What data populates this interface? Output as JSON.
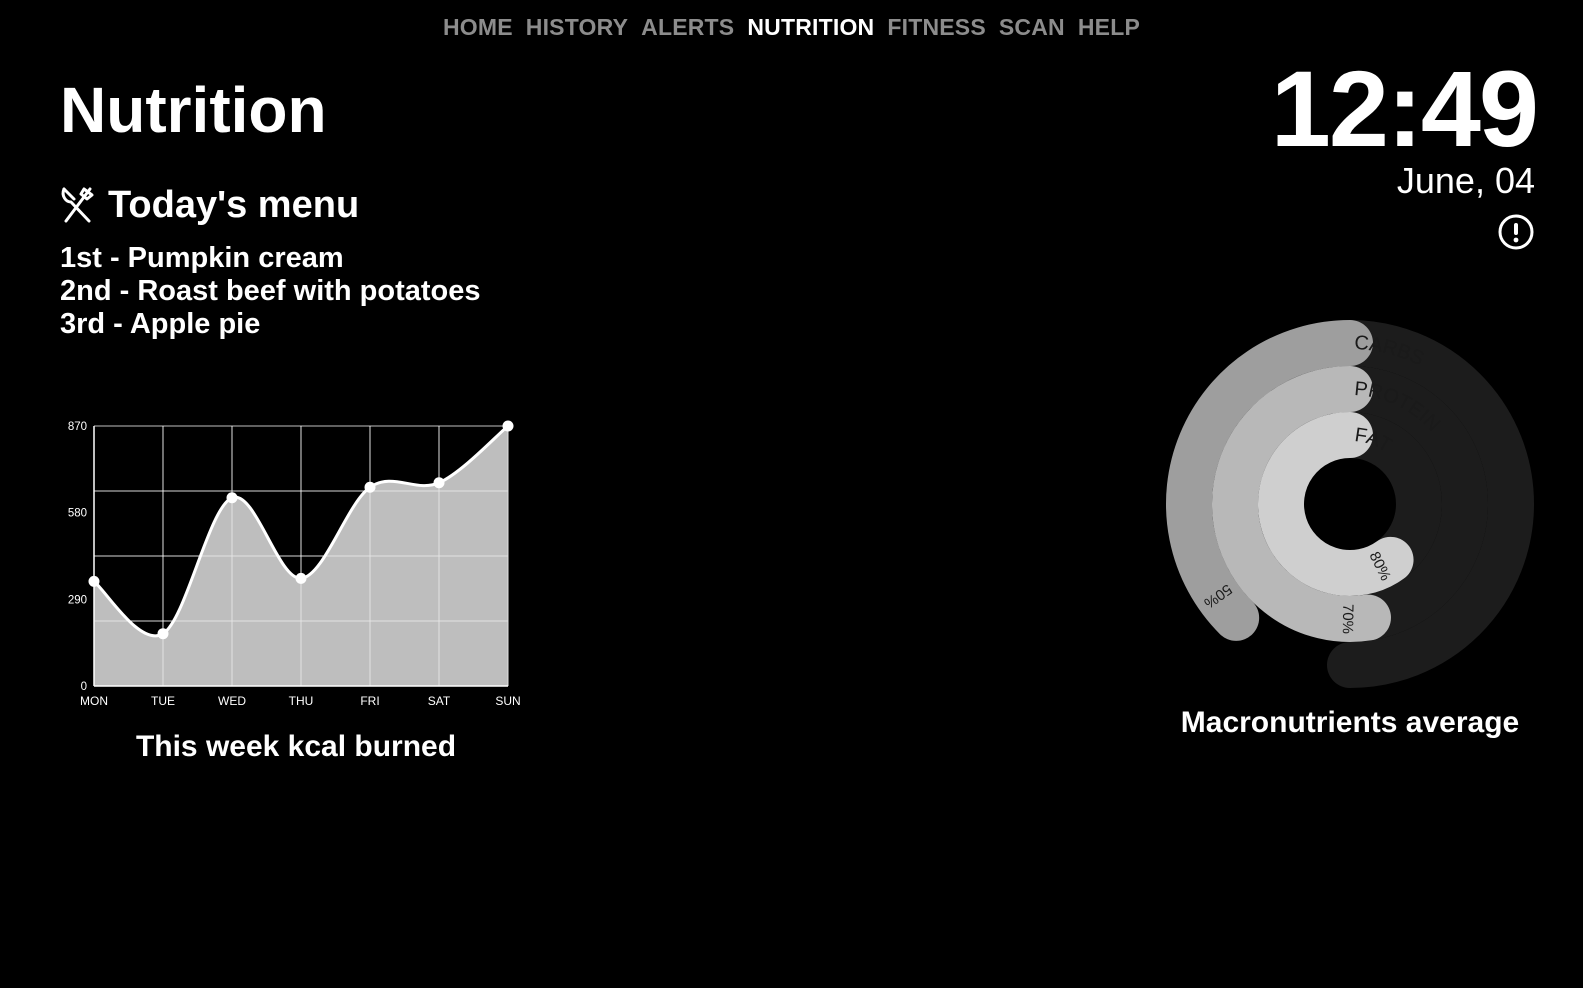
{
  "nav": {
    "items": [
      "HOME",
      "HISTORY",
      "ALERTS",
      "NUTRITION",
      "FITNESS",
      "SCAN",
      "HELP"
    ],
    "active": "NUTRITION"
  },
  "page": {
    "title": "Nutrition"
  },
  "menu": {
    "heading": "Today's menu",
    "icon": "fork-knife-icon",
    "items": [
      "1st - Pumpkin cream",
      "2nd - Roast beef with potatoes",
      "3rd - Apple pie"
    ]
  },
  "clock": {
    "time": "12:49",
    "date": "June, 04"
  },
  "alert": {
    "icon": "alert-circle-icon"
  },
  "chart_data": [
    {
      "type": "area",
      "categories": [
        "MON",
        "TUE",
        "WED",
        "THU",
        "FRI",
        "SAT",
        "SUN"
      ],
      "values": [
        350,
        175,
        630,
        360,
        665,
        680,
        870
      ],
      "yticks": [
        0,
        290,
        580,
        870
      ],
      "ylim": [
        0,
        870
      ],
      "caption": "This week kcal burned",
      "colors": {
        "fill": "#cccccc",
        "line": "#ffffff",
        "grid": "#ffffff",
        "background": "#000000"
      }
    },
    {
      "type": "radial-bar",
      "series": [
        {
          "name": "CARBS",
          "value": 50,
          "label": "50%",
          "color": "#9e9e9e"
        },
        {
          "name": "PROTEIN",
          "value": 70,
          "label": "70%",
          "color": "#b8b8b8"
        },
        {
          "name": "FAT",
          "value": 80,
          "label": "80%",
          "color": "#cfcfcf"
        }
      ],
      "max": 100,
      "track_color": "#1c1c1c",
      "caption": "Macronutrients average"
    }
  ]
}
